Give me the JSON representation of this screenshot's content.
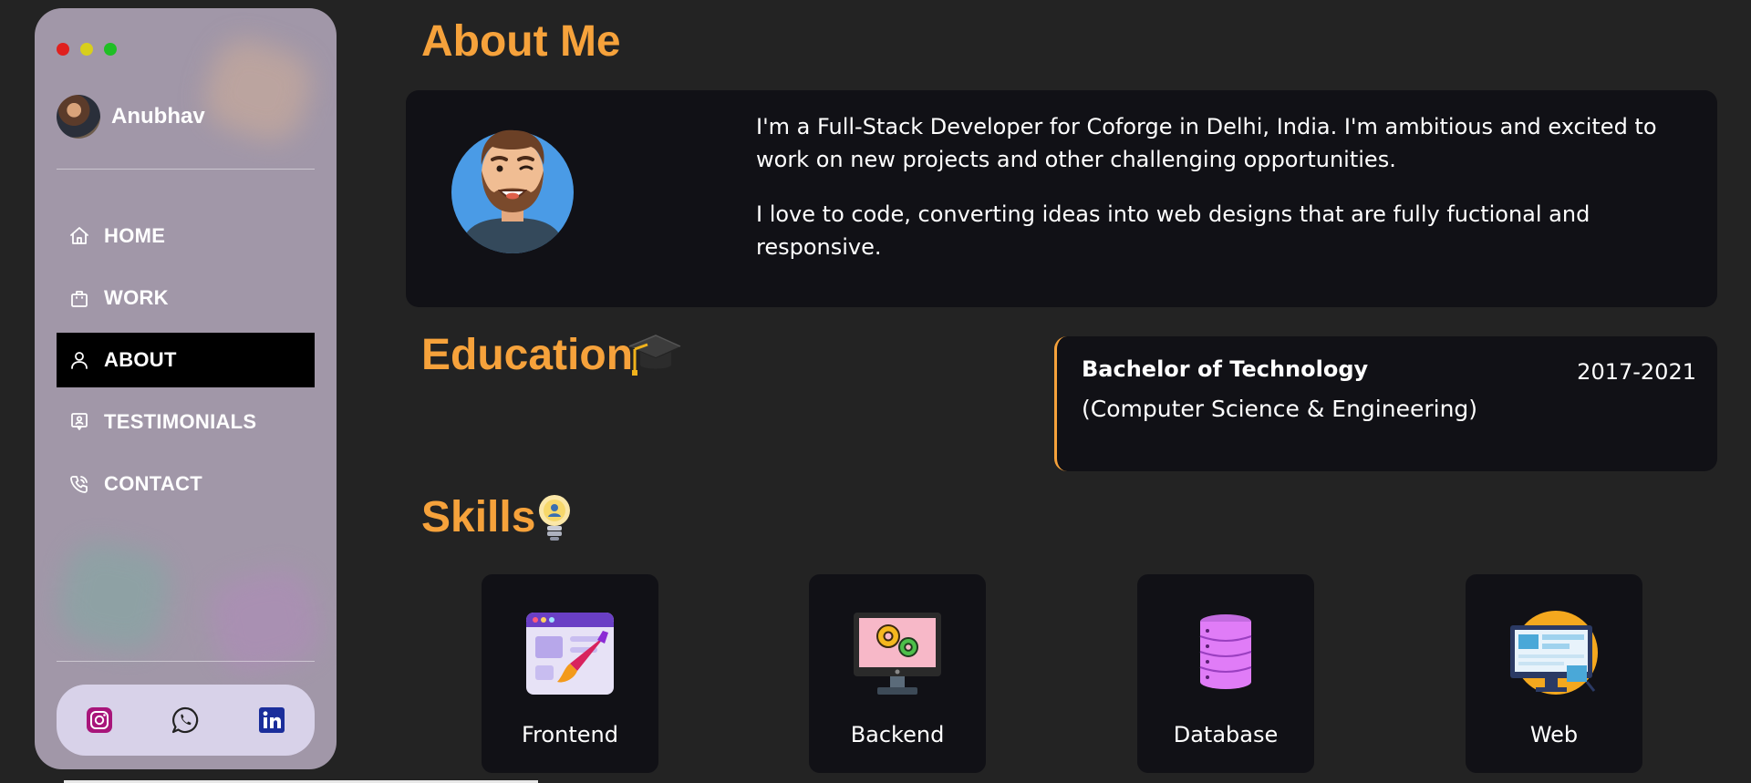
{
  "window_controls": [
    "close",
    "minimize",
    "maximize"
  ],
  "sidebar": {
    "profile_name": "Anubhav",
    "nav": [
      {
        "label": "HOME",
        "icon": "home-icon"
      },
      {
        "label": "WORK",
        "icon": "briefcase-icon"
      },
      {
        "label": "ABOUT",
        "icon": "user-icon",
        "active": true
      },
      {
        "label": "TESTIMONIALS",
        "icon": "testimonial-icon"
      },
      {
        "label": "CONTACT",
        "icon": "phone-icon"
      }
    ],
    "social": [
      "instagram-icon",
      "whatsapp-icon",
      "linkedin-icon"
    ]
  },
  "about": {
    "title": "About Me",
    "paragraphs": [
      "I'm a Full-Stack Developer for Coforge in Delhi, India. I'm ambitious and excited to work on new projects and other challenging opportunities.",
      "I love to code, converting ideas into web designs that are fully fuctional and responsive."
    ]
  },
  "education": {
    "title": "Education",
    "degree": "Bachelor of Technology",
    "field": "(Computer Science & Engineering)",
    "years": "2017-2021"
  },
  "skills": {
    "title": "Skills",
    "items": [
      {
        "label": "Frontend",
        "icon": "frontend-icon"
      },
      {
        "label": "Backend",
        "icon": "backend-icon"
      },
      {
        "label": "Database",
        "icon": "database-icon"
      },
      {
        "label": "Web",
        "icon": "web-icon"
      }
    ]
  },
  "colors": {
    "accent": "#f6a23b",
    "background": "#232323",
    "card": "#111116",
    "sidebar": "#a197a8"
  }
}
